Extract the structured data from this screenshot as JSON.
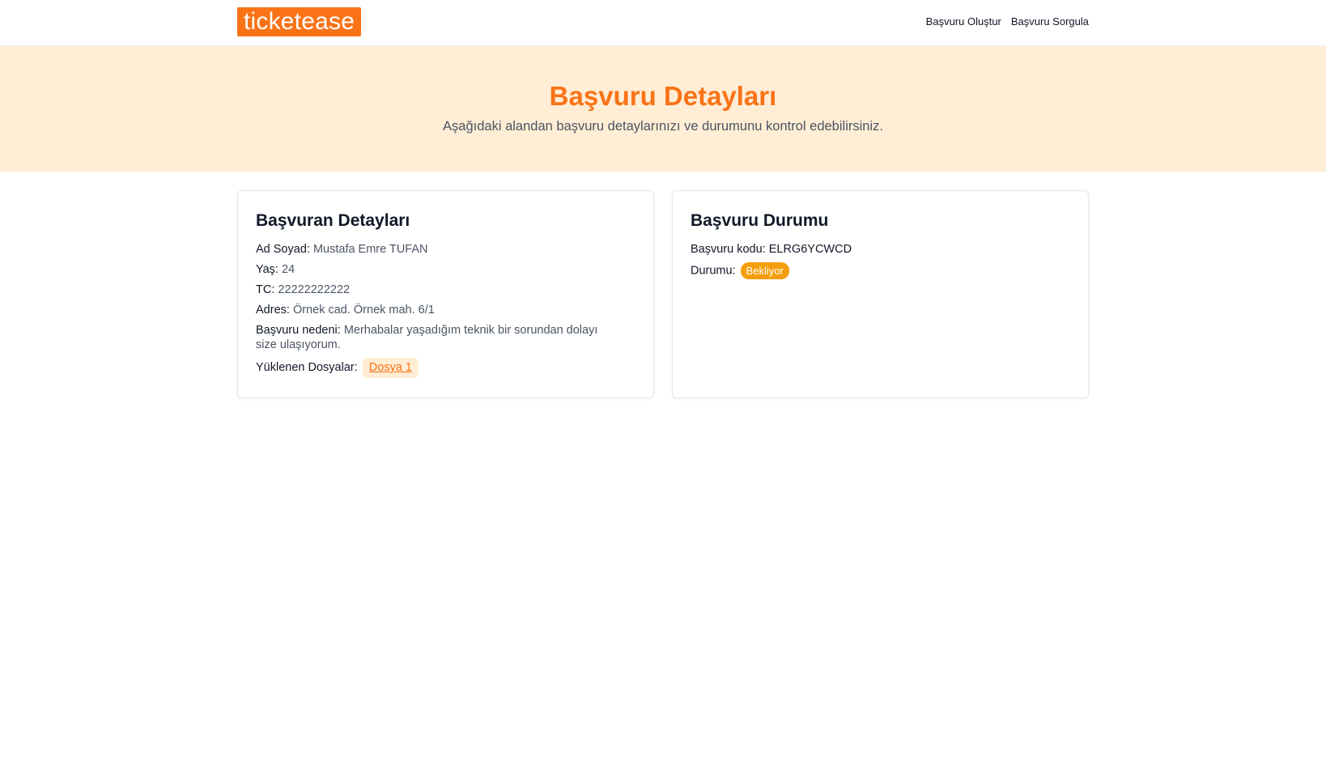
{
  "header": {
    "logo": "ticketease",
    "nav": [
      "Başvuru Oluştur",
      "Başvuru Sorgula"
    ]
  },
  "hero": {
    "title": "Başvuru Detayları",
    "subtitle": "Aşağıdaki alandan başvuru detaylarınızı ve durumunu kontrol edebilirsiniz."
  },
  "applicant": {
    "heading": "Başvuran Detayları",
    "fields": [
      {
        "label": "Ad Soyad:",
        "value": "Mustafa Emre TUFAN"
      },
      {
        "label": "Yaş:",
        "value": "24"
      },
      {
        "label": "TC:",
        "value": "22222222222"
      },
      {
        "label": "Adres:",
        "value": "Örnek cad. Örnek mah. 6/1"
      },
      {
        "label": "Başvuru nedeni:",
        "value": "Merhabalar yaşadığım teknik bir sorundan dolayı size ulaşıyorum."
      }
    ],
    "files_label": "Yüklenen Dosyalar:",
    "files": [
      "Dosya 1"
    ]
  },
  "status": {
    "heading": "Başvuru Durumu",
    "code_label": "Başvuru kodu:",
    "code_value": "ELRG6YCWCD",
    "status_label": "Durumu:",
    "status_value": "Bekliyor",
    "status_color": "#f59e0b"
  },
  "colors": {
    "accent": "#f97316",
    "hero_bg": "#ffedd5"
  }
}
